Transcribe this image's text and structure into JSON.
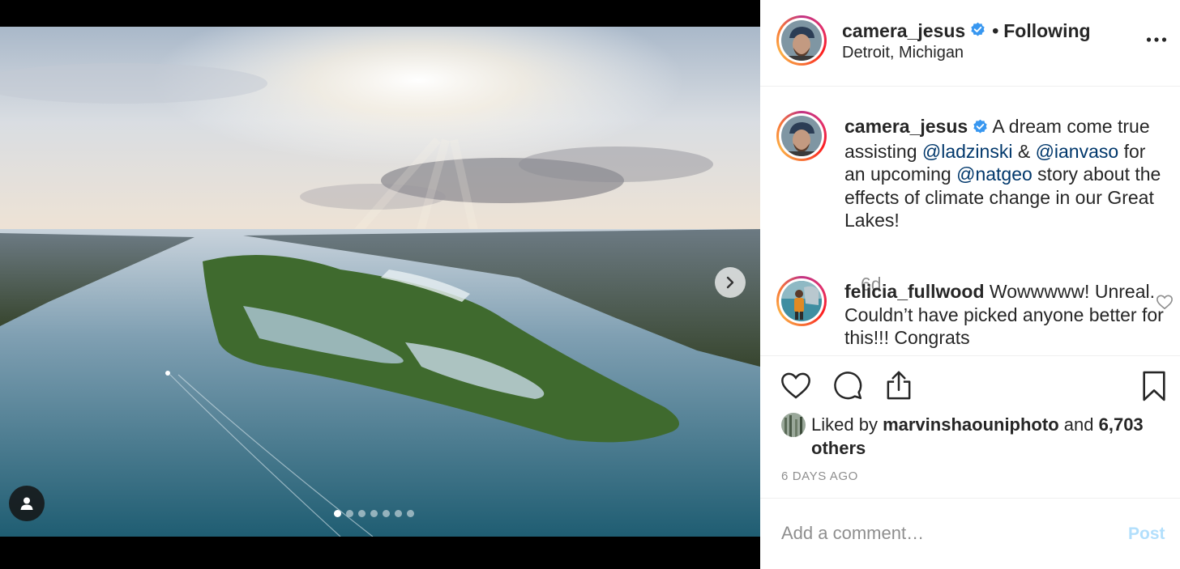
{
  "post": {
    "username": "camera_jesus",
    "separator": "•",
    "follow_status": "Following",
    "location": "Detroit, Michigan",
    "verified": true,
    "image_alt": "Aerial view of an island in a river under a sunlit cloudy sky",
    "carousel": {
      "total": 7,
      "current": 1
    }
  },
  "caption": {
    "username": "camera_jesus",
    "parts": [
      {
        "text": "A dream come true assisting ",
        "mention": false
      },
      {
        "text": "@ladzinski",
        "mention": true
      },
      {
        "text": " & ",
        "mention": false
      },
      {
        "text": "@ianvaso",
        "mention": true
      },
      {
        "text": " for an upcoming ",
        "mention": false
      },
      {
        "text": "@natgeo",
        "mention": true
      },
      {
        "text": " story about the effects of climate change in our Great Lakes!",
        "mention": false
      }
    ],
    "age": "6d"
  },
  "comments": [
    {
      "username": "felicia_fullwood",
      "text": "Wowwwww! Unreal. Couldn’t have picked anyone better for this!!! Congrats"
    }
  ],
  "likes": {
    "prefix": "Liked by",
    "user": "marvinshaouniphoto",
    "joiner": "and",
    "others": "6,703 others"
  },
  "timestamp": "6 DAYS AGO",
  "comment_box": {
    "placeholder": "Add a comment…",
    "post_label": "Post"
  },
  "colors": {
    "accent_link": "#00376b",
    "verified": "#3897f0",
    "post_disabled": "#b2dffc",
    "muted": "#8e8e8e"
  },
  "icons": [
    "next-arrow-icon",
    "user-tag-icon",
    "verified-badge-icon",
    "more-options-icon",
    "heart-icon",
    "comment-icon",
    "share-icon",
    "bookmark-icon"
  ]
}
